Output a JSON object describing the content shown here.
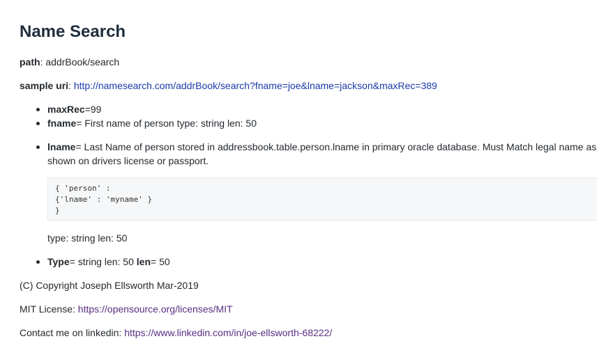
{
  "heading": "Name Search",
  "path": {
    "label": "path",
    "value": ": addrBook/search"
  },
  "sample_uri": {
    "label": "sample uri",
    "sep": ": ",
    "link": "http://namesearch.com/addrBook/search?fname=joe&lname=jackson&maxRec=389"
  },
  "params": [
    {
      "name": "maxRec",
      "desc": "=99"
    },
    {
      "name": "fname",
      "desc": "= First name of person type: string len: 50"
    }
  ],
  "lname": {
    "name": "lname",
    "desc_line1": "= Last Name of person stored in addressbook.table.person.lname in primary oracle database. Must Match legal name as",
    "desc_line2": "shown on drivers license or passport.",
    "code": [
      "{ 'person' :",
      "{'lname' : 'myname' }",
      "}"
    ],
    "type_note": "type: string len: 50"
  },
  "type_item": {
    "name": "Type",
    "desc": "= string len: 50 ",
    "len_label": "len",
    "len_value": "= 50"
  },
  "copyright": "(C) Copyright Joseph Ellsworth Mar-2019",
  "license": {
    "label": "MIT License: ",
    "link": "https://opensource.org/licenses/MIT"
  },
  "contact": {
    "label": "Contact me on linkedin: ",
    "link": "https://www.linkedin.com/in/joe-ellsworth-68222/"
  }
}
